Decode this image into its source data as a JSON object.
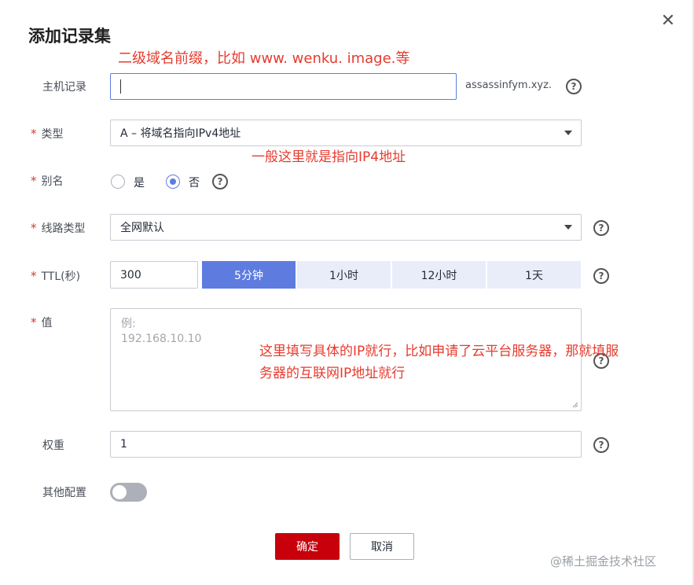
{
  "dialog": {
    "title": "添加记录集",
    "close_symbol": "✕"
  },
  "annotations": {
    "prefix_note": "二级域名前缀，比如 www.   wenku. image.等",
    "type_note": "一般这里就是指向IP4地址",
    "value_note_line1": "这里填写具体的IP就行，比如申请了云平台服务器，那就填服",
    "value_note_line2": "务器的互联网IP地址就行"
  },
  "form": {
    "required_mark": "*",
    "help_symbol": "?",
    "host": {
      "label": "主机记录",
      "value": "",
      "suffix": "assassinfym.xyz."
    },
    "type": {
      "label": "类型",
      "value": "A – 将域名指向IPv4地址"
    },
    "alias": {
      "label": "别名",
      "options": [
        "是",
        "否"
      ],
      "selected": "否"
    },
    "line": {
      "label": "线路类型",
      "value": "全网默认"
    },
    "ttl": {
      "label": "TTL(秒)",
      "value": "300",
      "presets": [
        "5分钟",
        "1小时",
        "12小时",
        "1天"
      ],
      "selected_preset": "5分钟"
    },
    "record_value": {
      "label": "值",
      "placeholder_line1": "例:",
      "placeholder_line2": "192.168.10.10"
    },
    "weight": {
      "label": "权重",
      "value": "1"
    },
    "other": {
      "label": "其他配置",
      "enabled": false
    }
  },
  "buttons": {
    "confirm": "确定",
    "cancel": "取消"
  },
  "watermark": "@稀土掘金技术社区",
  "colors": {
    "primary_button": "#c7000b",
    "accent": "#5e7ce0",
    "segment_bg": "#e9edfa",
    "annotation": "#e63b2e",
    "required": "#e0352b"
  }
}
